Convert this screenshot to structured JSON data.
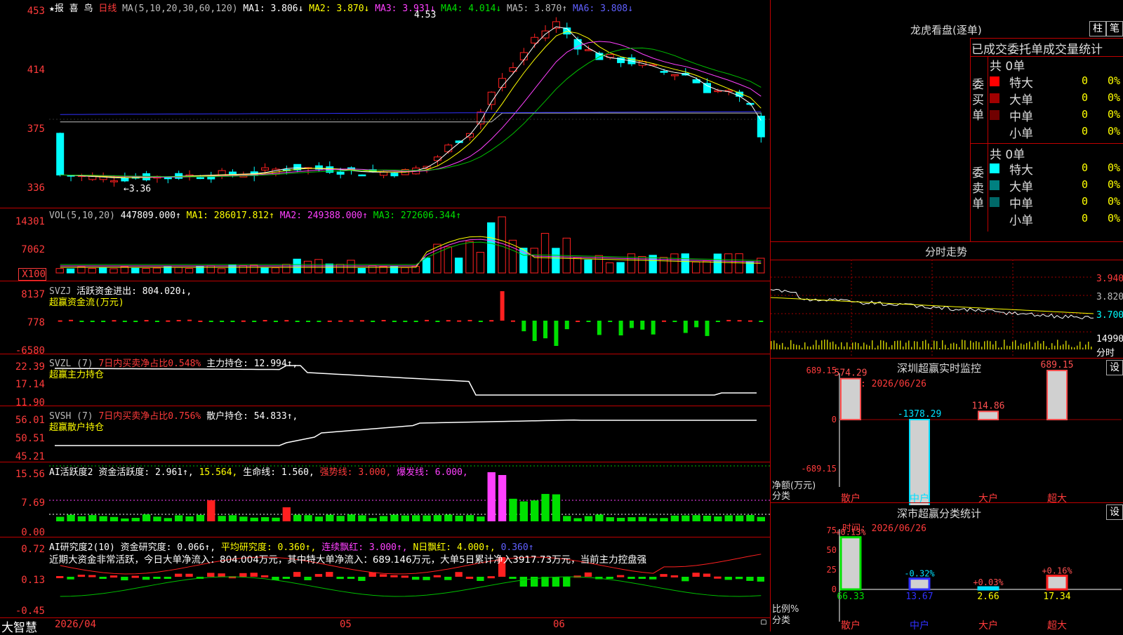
{
  "header": {
    "star": "★报 喜 鸟",
    "period": "日线",
    "ma_label": "MA(5,10,20,30,60,120)",
    "ma1": "MA1: 3.806↓",
    "ma2": "MA2: 3.870↓",
    "ma3": "MA3: 3.931↓",
    "ma4": "MA4: 4.014↓",
    "ma5": "MA5: 3.870↑",
    "ma6": "MA6: 3.808↓"
  },
  "price_axis": [
    "453",
    "414",
    "375",
    "336"
  ],
  "price_notes": {
    "high": "4.53",
    "low": "←3.36"
  },
  "vol": {
    "label": "VOL(5,10,20)",
    "value": "447809.000↑",
    "ma1": "MA1: 286017.812↑",
    "ma2": "MA2: 249388.000↑",
    "ma3": "MA3: 272606.344↑",
    "axis": [
      "14301",
      "7062",
      "X100"
    ]
  },
  "svzj": {
    "label": "SVZJ",
    "text": "活跃资金进出: 804.020↓,",
    "sub": "超赢资金流(万元)",
    "axis": [
      "8137",
      "778",
      "-6580"
    ]
  },
  "svzl": {
    "label": "SVZL (7)",
    "text1": "7日内买卖净占比0.548%",
    "text2": "主力持仓: 12.994↑,",
    "sub": "超赢主力持仓",
    "axis": [
      "22.39",
      "17.14",
      "11.90"
    ]
  },
  "svsh": {
    "label": "SVSH (7)",
    "text1": "7日内买卖净占比0.756%",
    "text2": "散户持仓: 54.833↑,",
    "sub": "超赢散户持仓",
    "axis": [
      "56.01",
      "50.51",
      "45.21"
    ]
  },
  "ai1": {
    "label": "AI活跃度2",
    "t1": "资金活跃度: 2.961↑,",
    "t2": "15.564,",
    "t3": "生命线: 1.560,",
    "t4": "强势线: 3.000,",
    "t5": "爆发线: 6.000,",
    "axis": [
      "15.56",
      "7.69",
      "0.00"
    ]
  },
  "ai2": {
    "label": "AI研究度2(10)",
    "t1": "资金研究度: 0.066↑,",
    "t2": "平均研究度: 0.360↑,",
    "t3": "连续飘红: 3.000↑,",
    "t4": "N日飘红: 4.000↑,",
    "t5": "0.360↑",
    "summary": "近期大资金非常活跃，今日大单净流入：804.004万元，其中特大单净流入：689.146万元，大单5日累计净入3917.73万元，当前主力控盘强",
    "axis": [
      "0.72",
      "0.13",
      "-0.45"
    ]
  },
  "bottom": {
    "brand": "大智慧",
    "date": "2026/04",
    "m05": "05",
    "m06": "06"
  },
  "longhu": {
    "title": "龙虎看盘(逐单)",
    "btn1": "柱",
    "btn2": "笔",
    "subtitle": "已成交委托单成交量统计",
    "buy_label": "委买单",
    "sell_label": "委卖单",
    "buy_total": "共 0单",
    "sell_total": "共 0单",
    "buy_rows": [
      {
        "name": "特大",
        "count": "0",
        "pct": "0%",
        "color": "#ff0000"
      },
      {
        "name": "大单",
        "count": "0",
        "pct": "0%",
        "color": "#a00000"
      },
      {
        "name": "中单",
        "count": "0",
        "pct": "0%",
        "color": "#700000"
      },
      {
        "name": "小单",
        "count": "0",
        "pct": "0%",
        "color": "#000000"
      }
    ],
    "sell_rows": [
      {
        "name": "特大",
        "count": "0",
        "pct": "0%",
        "color": "#00ffff"
      },
      {
        "name": "大单",
        "count": "0",
        "pct": "0%",
        "color": "#008080"
      },
      {
        "name": "中单",
        "count": "0",
        "pct": "0%",
        "color": "#006868"
      },
      {
        "name": "小单",
        "count": "0",
        "pct": "0%",
        "color": "#000000"
      }
    ]
  },
  "intraday": {
    "title": "分时走势",
    "axis": [
      "3.940",
      "3.820",
      "3.700"
    ],
    "vol_axis": "14990",
    "label": "分时"
  },
  "monitor": {
    "title": "深圳超赢实时监控",
    "btn": "设",
    "date": "时间: 2026/06/26",
    "axis": [
      "689.15",
      "0",
      "-689.15",
      "-1378.29"
    ],
    "ylabel": "净额(万元)",
    "xlabel": "分类",
    "bars": [
      {
        "cat": "散户",
        "value": "574.29"
      },
      {
        "cat": "中户",
        "value": "-1378.29"
      },
      {
        "cat": "大户",
        "value": "114.86"
      },
      {
        "cat": "超大",
        "value": "689.15"
      }
    ]
  },
  "classify": {
    "title": "深市超赢分类统计",
    "btn": "设",
    "date": "时间: 2026/06/26",
    "axis": [
      "75",
      "50",
      "25",
      "0"
    ],
    "ylabel": "比例%",
    "xlabel": "分类",
    "bars": [
      {
        "cat": "散户",
        "change": "+0.13%",
        "value": "66.33"
      },
      {
        "cat": "中户",
        "change": "-0.32%",
        "value": "13.67"
      },
      {
        "cat": "大户",
        "change": "+0.03%",
        "value": "2.66"
      },
      {
        "cat": "超大",
        "change": "+0.16%",
        "value": "17.34"
      }
    ]
  }
}
